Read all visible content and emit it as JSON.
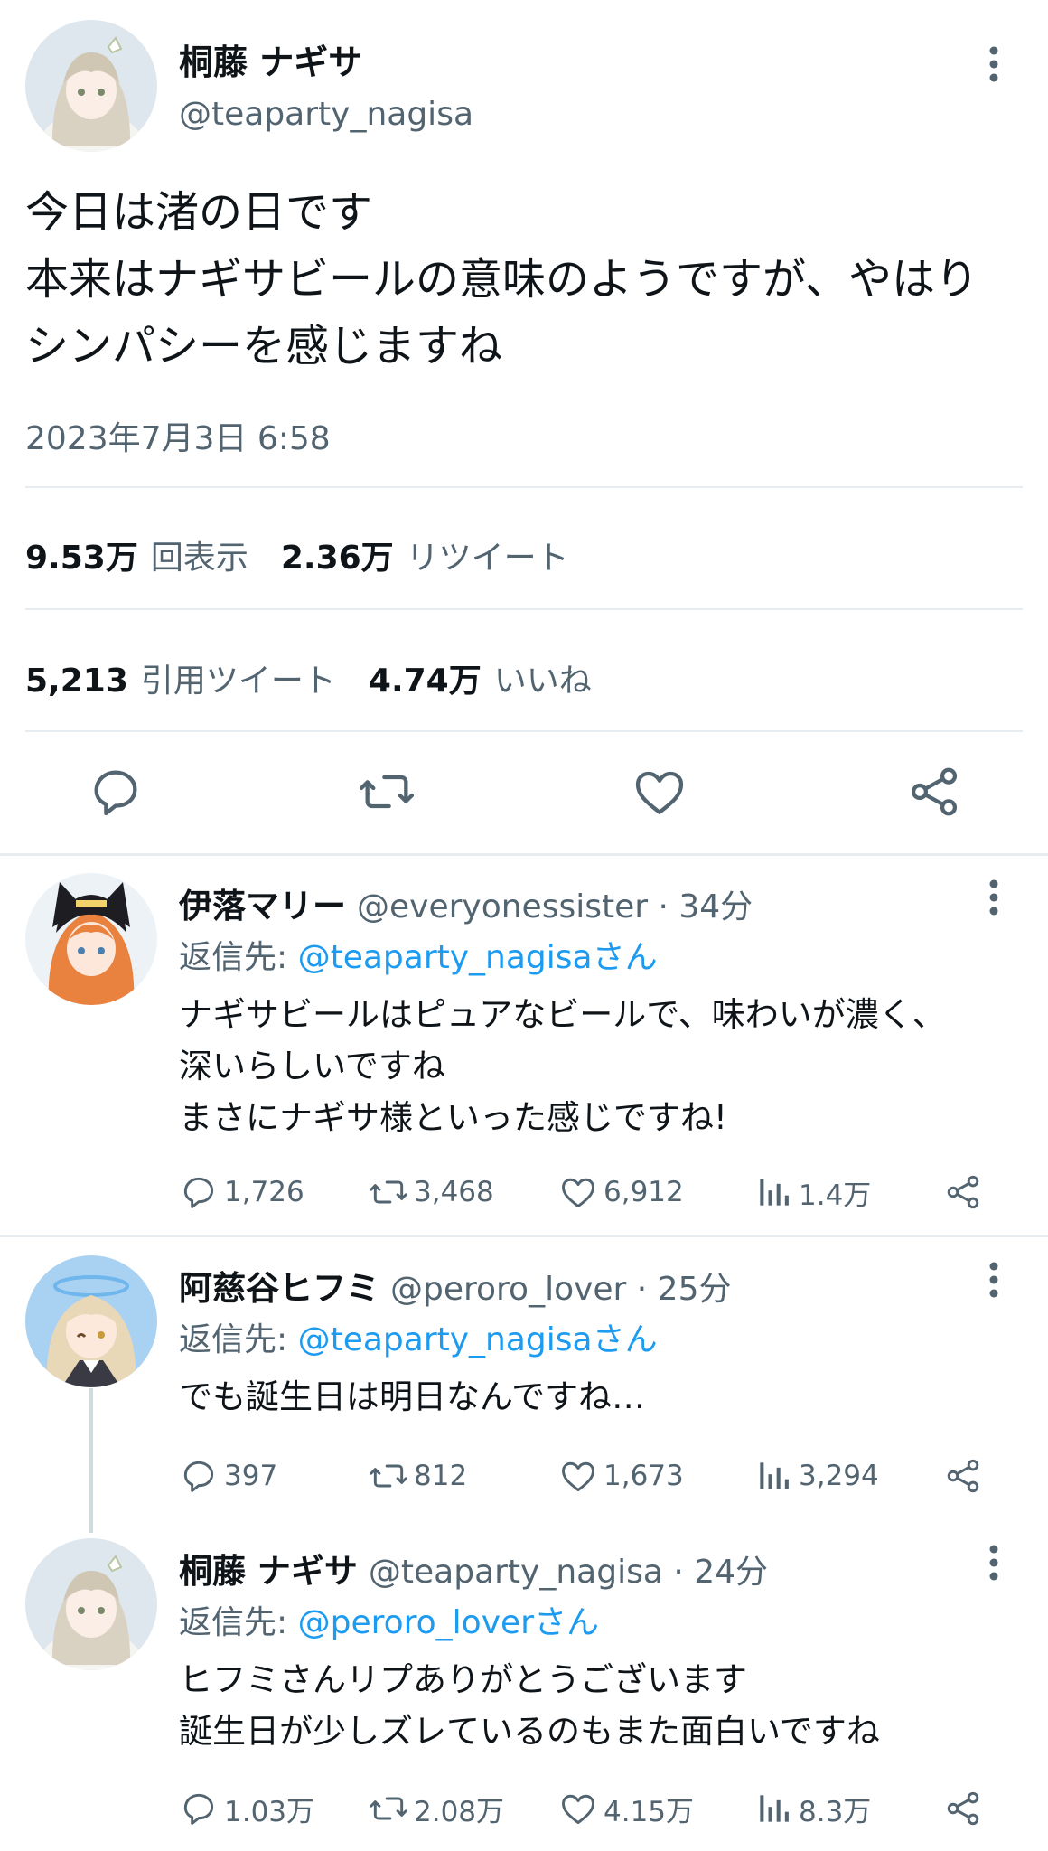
{
  "main_tweet": {
    "display_name": "桐藤 ナギサ",
    "handle": "@teaparty_nagisa",
    "body": "今日は渚の日です\n本来はナギサビールの意味のようですが、やはり\nシンパシーを感じますね",
    "timestamp": "2023年7月3日 6:58",
    "stats": {
      "views_value": "9.53万",
      "views_label": "回表示",
      "retweets_value": "2.36万",
      "retweets_label": "リツイート",
      "quotes_value": "5,213",
      "quotes_label": "引用ツイート",
      "likes_value": "4.74万",
      "likes_label": "いいね"
    },
    "actions": [
      "reply-icon",
      "retweet-icon",
      "like-icon",
      "share-icon"
    ]
  },
  "replies": [
    {
      "display_name": "伊落マリー",
      "handle_time": "@everyonessister · 34分",
      "reply_prefix": "返信先:",
      "reply_to": "@teaparty_nagisaさん",
      "body": "ナギサビールはピュアなビールで、味わいが濃く、\n深いらしいですね\nまさにナギサ様といった感じですね!",
      "replies": "1,726",
      "retweets": "3,468",
      "likes": "6,912",
      "views": "1.4万"
    },
    {
      "display_name": "阿慈谷ヒフミ",
      "handle_time": "@peroro_lover · 25分",
      "reply_prefix": "返信先:",
      "reply_to": "@teaparty_nagisaさん",
      "body": "でも誕生日は明日なんですね…",
      "replies": "397",
      "retweets": "812",
      "likes": "1,673",
      "views": "3,294"
    },
    {
      "display_name": "桐藤 ナギサ",
      "handle_time": "@teaparty_nagisa · 24分",
      "reply_prefix": "返信先:",
      "reply_to": "@peroro_loverさん",
      "body": "ヒフミさんリプありがとうございます\n誕生日が少しズレているのもまた面白いですね",
      "replies": "1.03万",
      "retweets": "2.08万",
      "likes": "4.15万",
      "views": "8.3万"
    }
  ],
  "colors": {
    "text": "#0f1419",
    "muted": "#536471",
    "link": "#1d9bf0",
    "divider": "#e6ecf0"
  }
}
